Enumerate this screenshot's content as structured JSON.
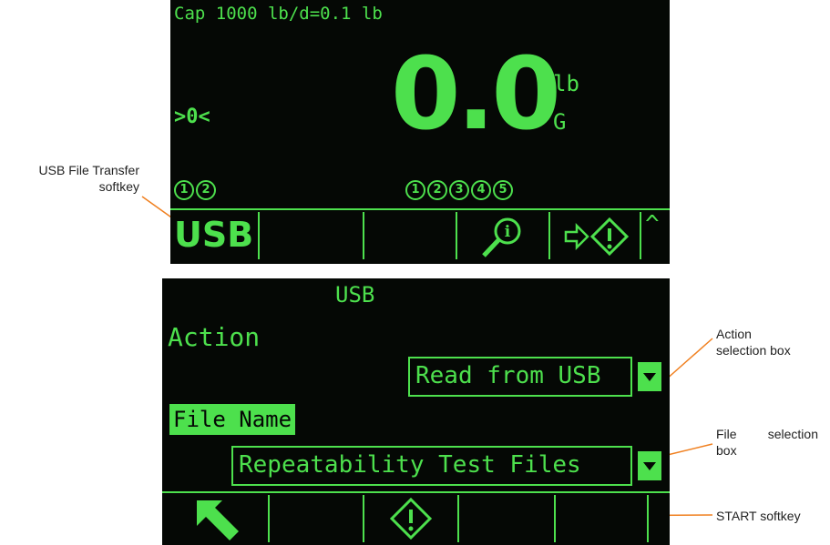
{
  "callouts": {
    "usb_softkey": [
      "USB File Transfer",
      "softkey"
    ],
    "action_box": [
      "Action",
      "selection box"
    ],
    "file_box": [
      "File",
      "selection",
      "box"
    ],
    "start_softkey": "START softkey"
  },
  "home_screen": {
    "capacity_line": "Cap 1000 lb/d=0.1 lb",
    "zero_indicator": ">0<",
    "weight_value": "0.0",
    "unit": "lb",
    "mode": "G",
    "left_indicators": [
      "1",
      "2"
    ],
    "center_indicators": [
      "1",
      "2",
      "3",
      "4",
      "5"
    ],
    "softkeys": [
      {
        "label": "USB",
        "icon": "usb-text"
      },
      {
        "label": "",
        "icon": ""
      },
      {
        "label": "",
        "icon": ""
      },
      {
        "label": "",
        "icon": "info-magnifier-icon"
      },
      {
        "label": "",
        "icon": "arrow-start-icon"
      },
      {
        "label": "^",
        "icon": "caret-up-icon"
      }
    ],
    "color": "#4de04d"
  },
  "usb_screen": {
    "title": "USB",
    "action_label": "Action",
    "action_value": "Read from USB",
    "file_label": "File Name",
    "file_value": "Repeatability Test Files",
    "softkeys": [
      {
        "icon": "exit-arrow-icon"
      },
      {
        "icon": ""
      },
      {
        "icon": "start-diamond-icon"
      },
      {
        "icon": ""
      },
      {
        "icon": ""
      },
      {
        "icon": ""
      }
    ]
  }
}
